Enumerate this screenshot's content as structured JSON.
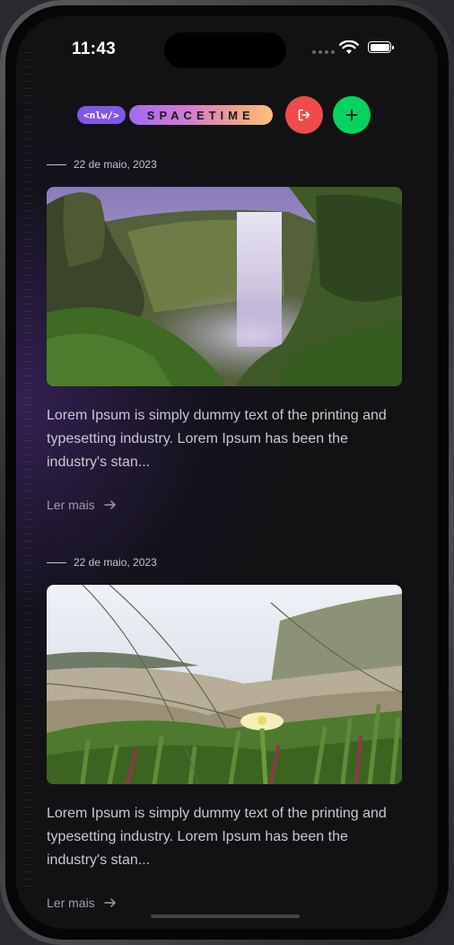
{
  "status_bar": {
    "time": "11:43"
  },
  "header": {
    "logo_badge": "<nlw/>",
    "logo_word": "SPACETIME"
  },
  "memories": [
    {
      "date": "22 de maio, 2023",
      "excerpt": "Lorem Ipsum is simply dummy text of the printing and typesetting industry. Lorem Ipsum has been the industry's stan...",
      "read_more": "Ler mais"
    },
    {
      "date": "22 de maio, 2023",
      "excerpt": "Lorem Ipsum is simply dummy text of the printing and typesetting industry. Lorem Ipsum has been the industry's stan...",
      "read_more": "Ler mais"
    }
  ],
  "colors": {
    "logout": "#ef4b4b",
    "add": "#04d361",
    "brand_purple": "#8257e5"
  }
}
